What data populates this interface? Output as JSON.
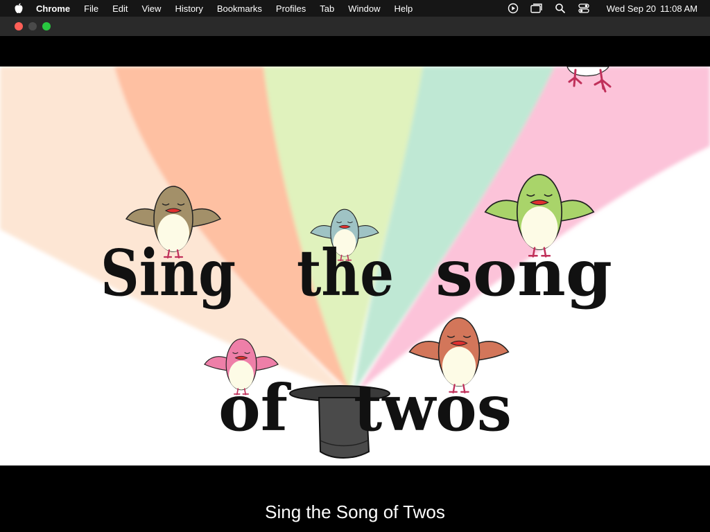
{
  "menubar": {
    "apple_icon": "apple-logo-icon",
    "items": [
      "Chrome",
      "File",
      "Edit",
      "View",
      "History",
      "Bookmarks",
      "Profiles",
      "Tab",
      "Window",
      "Help"
    ],
    "status_icons": [
      "play-circle-icon",
      "windows-icon",
      "search-icon",
      "control-center-icon"
    ],
    "date": "Wed Sep 20",
    "time": "11:08 AM"
  },
  "window": {
    "traffic_lights": {
      "close": "#ff5f57",
      "minimize": "#4a4a4a",
      "zoom": "#28c840"
    }
  },
  "video": {
    "title_words": [
      "Sing",
      "the",
      "song",
      "of",
      "twos"
    ],
    "caption": "Sing the Song of Twos",
    "bird_colors": [
      "#a39069",
      "#9fc3c4",
      "#a9d46a",
      "#ee7fa8",
      "#d3765a"
    ],
    "rainbow_colors": [
      "#fde6d4",
      "#fec0a2",
      "#e0f2bd",
      "#bfe8d4",
      "#fcc3d9"
    ]
  }
}
